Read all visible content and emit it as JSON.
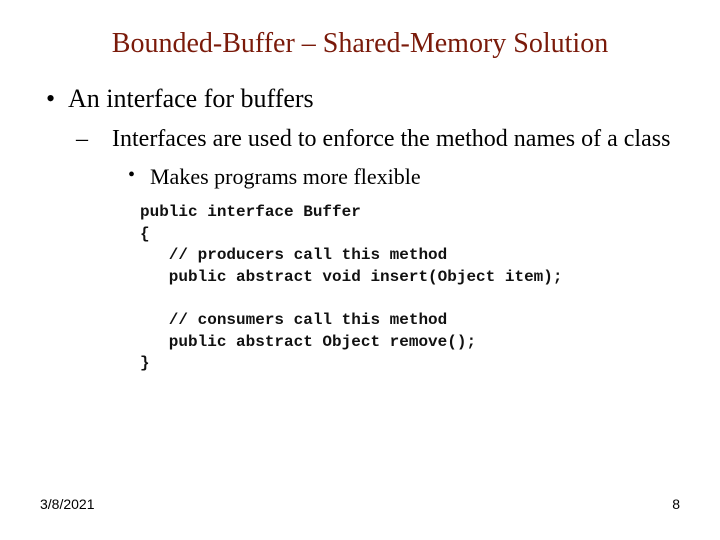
{
  "title": "Bounded-Buffer – Shared-Memory Solution",
  "bullets": {
    "l1": "An interface for buffers",
    "l2": "Interfaces are used to enforce the method names of a class",
    "l3": "Makes programs more flexible"
  },
  "code": "public interface Buffer\n{\n   // producers call this method\n   public abstract void insert(Object item);\n\n   // consumers call this method\n   public abstract Object remove();\n}",
  "footer": {
    "date": "3/8/2021",
    "page": "8"
  }
}
